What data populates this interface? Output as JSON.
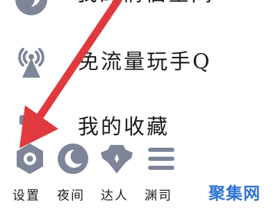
{
  "menu": {
    "items": [
      {
        "label": "我的情侣空间",
        "icon": "heart-face-icon"
      },
      {
        "label": "免流量玩手Q",
        "icon": "signal-tower-icon"
      },
      {
        "label": "我的收藏",
        "icon": "bookmark-icon"
      }
    ]
  },
  "toolbar": {
    "items": [
      {
        "label": "设置",
        "icon": "gear-icon"
      },
      {
        "label": "夜间",
        "icon": "moon-icon"
      },
      {
        "label": "达人",
        "icon": "badge-icon"
      },
      {
        "label": "渊司",
        "icon": "menu-icon"
      }
    ]
  },
  "annotation": {
    "arrow_color": "#e03a3e",
    "target": "settings"
  },
  "watermark": {
    "text": "聚集网",
    "color": "#2f74d6"
  },
  "colors": {
    "icon": "#7e8599",
    "text": "#1b1b1b",
    "background": "#ffffff"
  }
}
